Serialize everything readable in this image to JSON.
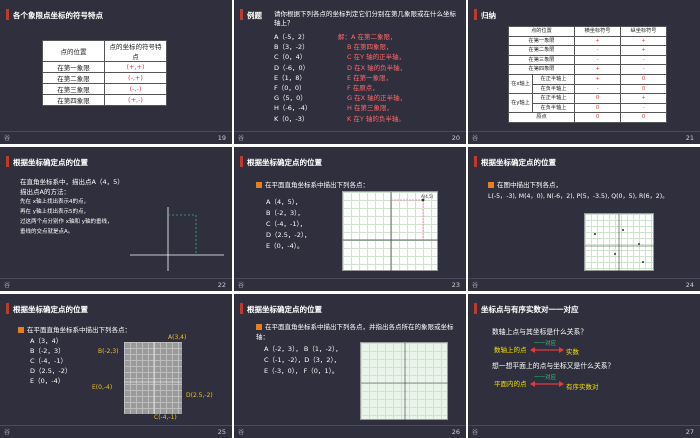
{
  "slides": [
    {
      "num": "19",
      "title": "各个象限点坐标的符号特点",
      "table": {
        "headers": [
          "点的位置",
          "点的坐标的符号特点"
        ],
        "rows": [
          [
            "在第一象限",
            "(+,+)"
          ],
          [
            "在第二象限",
            "(-,+)"
          ],
          [
            "在第三象限",
            "(-,-)"
          ],
          [
            "在第四象限",
            "(+,-)"
          ]
        ]
      }
    },
    {
      "num": "20",
      "title": "例题",
      "question": "请你根据下列各点的坐标判定它们分别在第几象限或在什么坐标轴上？",
      "points": [
        "A（-5，2）",
        "B（3，-2）",
        "C（0，4）",
        "D（-6，0）",
        "E（1，8）",
        "F（0，0）",
        "G（5，0）",
        "H（-6，-4）",
        "K（0，-3）"
      ],
      "answers": [
        "解：A 在第二象限，",
        "B 在第四象限，",
        "C 在Y 轴的正半轴，",
        "D 在X 轴的负半轴，",
        "E 在第一象限，",
        "F 在原点，",
        "G 在X 轴的正半轴，",
        "H 在第三象限，",
        "K 在Y 轴的负半轴。"
      ]
    },
    {
      "num": "21",
      "title": "归纳",
      "headers": [
        "点的位置",
        "横坐标符号",
        "纵坐标符号"
      ],
      "rows": [
        [
          "",
          "在第一象限",
          "+",
          "+"
        ],
        [
          "",
          "在第二象限",
          "-",
          "+"
        ],
        [
          "",
          "在第三象限",
          "-",
          "-"
        ],
        [
          "",
          "在第四象限",
          "+",
          "-"
        ],
        [
          "在x轴上",
          "在正半轴上",
          "+",
          "0"
        ],
        [
          "",
          "在负半轴上",
          "-",
          "0"
        ],
        [
          "在y轴上",
          "在正半轴上",
          "0",
          "+"
        ],
        [
          "",
          "在负半轴上",
          "0",
          "-"
        ],
        [
          "",
          "原点",
          "0",
          "0"
        ]
      ]
    },
    {
      "num": "22",
      "title": "根据坐标确定点的位置",
      "lines": [
        "在直角坐标系中，描出点A（4，5）",
        "描出点A的方法：",
        "先在 x轴上找出表示4的点，",
        "再在 y轴上找出表示5的点，",
        "过这两个点分别作 x轴和 y轴的垂线，",
        "垂线的交点就是点A。"
      ]
    },
    {
      "num": "23",
      "title": "根据坐标确定点的位置",
      "instruction": "在平面直角坐标系中描出下列各点：",
      "points": [
        "A（4，5），",
        "B（-2，3），",
        "C（-4，-1），",
        "D（2.5，-2），",
        "E（0，-4）。"
      ],
      "marker": "A(4,5)"
    },
    {
      "num": "24",
      "title": "根据坐标确定点的位置",
      "instruction": "在图中描出下列各点，",
      "points": "L(-5，-3), M(4，0), N(-6，2), P(5，-3.5), Q(0，5), R(6，2)。"
    },
    {
      "num": "25",
      "title": "根据坐标确定点的位置",
      "instruction": "在平面直角坐标系中描出下列各点：",
      "points": [
        "A（3，4）",
        "B（-2，3）",
        "C（-4，-1）",
        "D（2.5，-2）",
        "E（0，-4）"
      ],
      "labels": {
        "a": "A(3,4)",
        "b": "B(-2,3)",
        "c": "C(-4,-1)",
        "d": "D(2.5,-2)",
        "e": "E(0,-4)"
      }
    },
    {
      "num": "26",
      "title": "根据坐标确定点的位置",
      "instruction": "在平面直角坐标系中描出下列各点，并指出各点所在的象限或坐标轴：",
      "points": [
        "A（-2，3），",
        "B（1，-2），",
        "C（-1，-2），D（3，2），",
        "E（-3，0），",
        "F（0，1）。"
      ]
    },
    {
      "num": "27",
      "title": "坐标点与有序实数对一一对应",
      "q1": "数轴上点与其坐标是什么关系？",
      "left1": "数轴上的点",
      "mid1": "一一对应",
      "right1": "实数",
      "q2": "想一想平面上的点与坐标又是什么关系？",
      "left2": "平面内的点",
      "mid2": "一一对应",
      "right2": "有序实数对"
    }
  ],
  "footer_logo": "谷"
}
